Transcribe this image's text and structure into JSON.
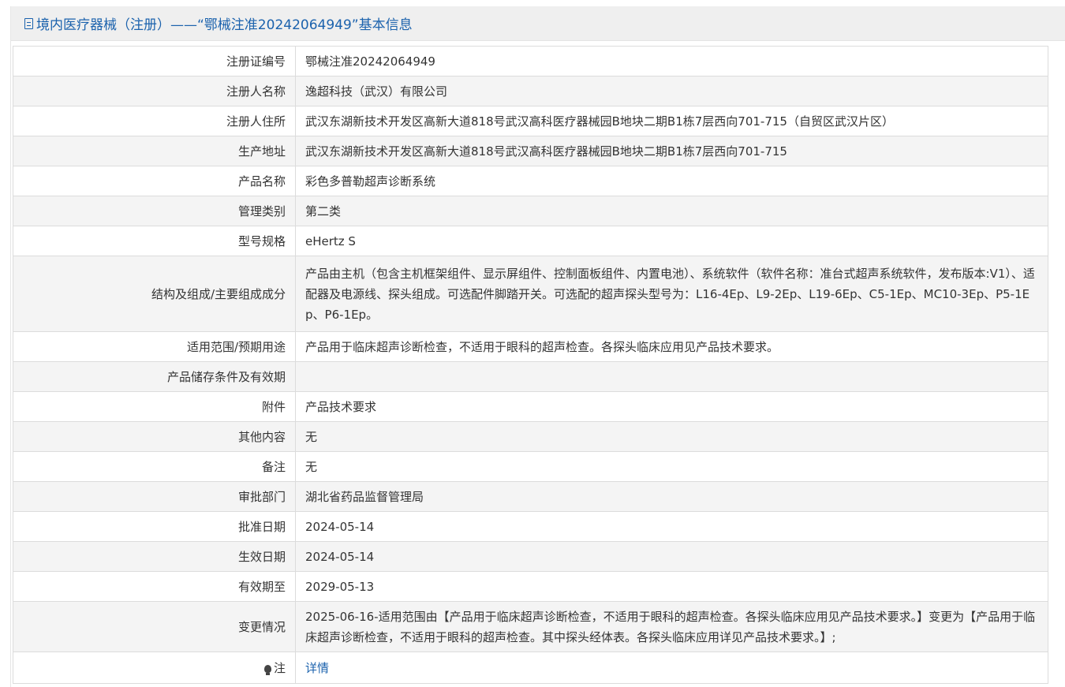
{
  "header": {
    "title": "境内医疗器械（注册）——“鄂械注准20242064949”基本信息"
  },
  "rows": [
    {
      "label": "注册证编号",
      "value": "鄂械注准20242064949"
    },
    {
      "label": "注册人名称",
      "value": "逸超科技（武汉）有限公司"
    },
    {
      "label": "注册人住所",
      "value": "武汉东湖新技术开发区高新大道818号武汉高科医疗器械园B地块二期B1栋7层西向701-715（自贸区武汉片区）"
    },
    {
      "label": "生产地址",
      "value": "武汉东湖新技术开发区高新大道818号武汉高科医疗器械园B地块二期B1栋7层西向701-715"
    },
    {
      "label": "产品名称",
      "value": "彩色多普勒超声诊断系统"
    },
    {
      "label": "管理类别",
      "value": "第二类"
    },
    {
      "label": "型号规格",
      "value": "eHertz S"
    },
    {
      "label": "结构及组成/主要组成成分",
      "value": "产品由主机（包含主机框架组件、显示屏组件、控制面板组件、内置电池）、系统软件（软件名称：准台式超声系统软件，发布版本:V1）、适配器及电源线、探头组成。可选配件脚踏开关。可选配的超声探头型号为：L16-4Ep、L9-2Ep、L19-6Ep、C5-1Ep、MC10-3Ep、P5-1Ep、P6-1Ep。"
    },
    {
      "label": "适用范围/预期用途",
      "value": "产品用于临床超声诊断检查，不适用于眼科的超声检查。各探头临床应用见产品技术要求。"
    },
    {
      "label": "产品储存条件及有效期",
      "value": ""
    },
    {
      "label": "附件",
      "value": "产品技术要求"
    },
    {
      "label": "其他内容",
      "value": "无"
    },
    {
      "label": "备注",
      "value": "无"
    },
    {
      "label": "审批部门",
      "value": "湖北省药品监督管理局"
    },
    {
      "label": "批准日期",
      "value": "2024-05-14"
    },
    {
      "label": "生效日期",
      "value": "2024-05-14"
    },
    {
      "label": "有效期至",
      "value": "2029-05-13"
    },
    {
      "label": "变更情况",
      "value": "2025-06-16-适用范围由【产品用于临床超声诊断检查，不适用于眼科的超声检查。各探头临床应用见产品技术要求。】变更为【产品用于临床超声诊断检查，不适用于眼科的超声检查。其中探头经体表。各探头临床应用详见产品技术要求。】;"
    }
  ],
  "note": {
    "icon": "lightbulb-icon",
    "label": "注",
    "link": "详情"
  },
  "colors": {
    "accent": "#1b62ad",
    "header_bg": "#efefef",
    "row_alt": "#f4f4f4",
    "border": "#dcdcdc"
  }
}
